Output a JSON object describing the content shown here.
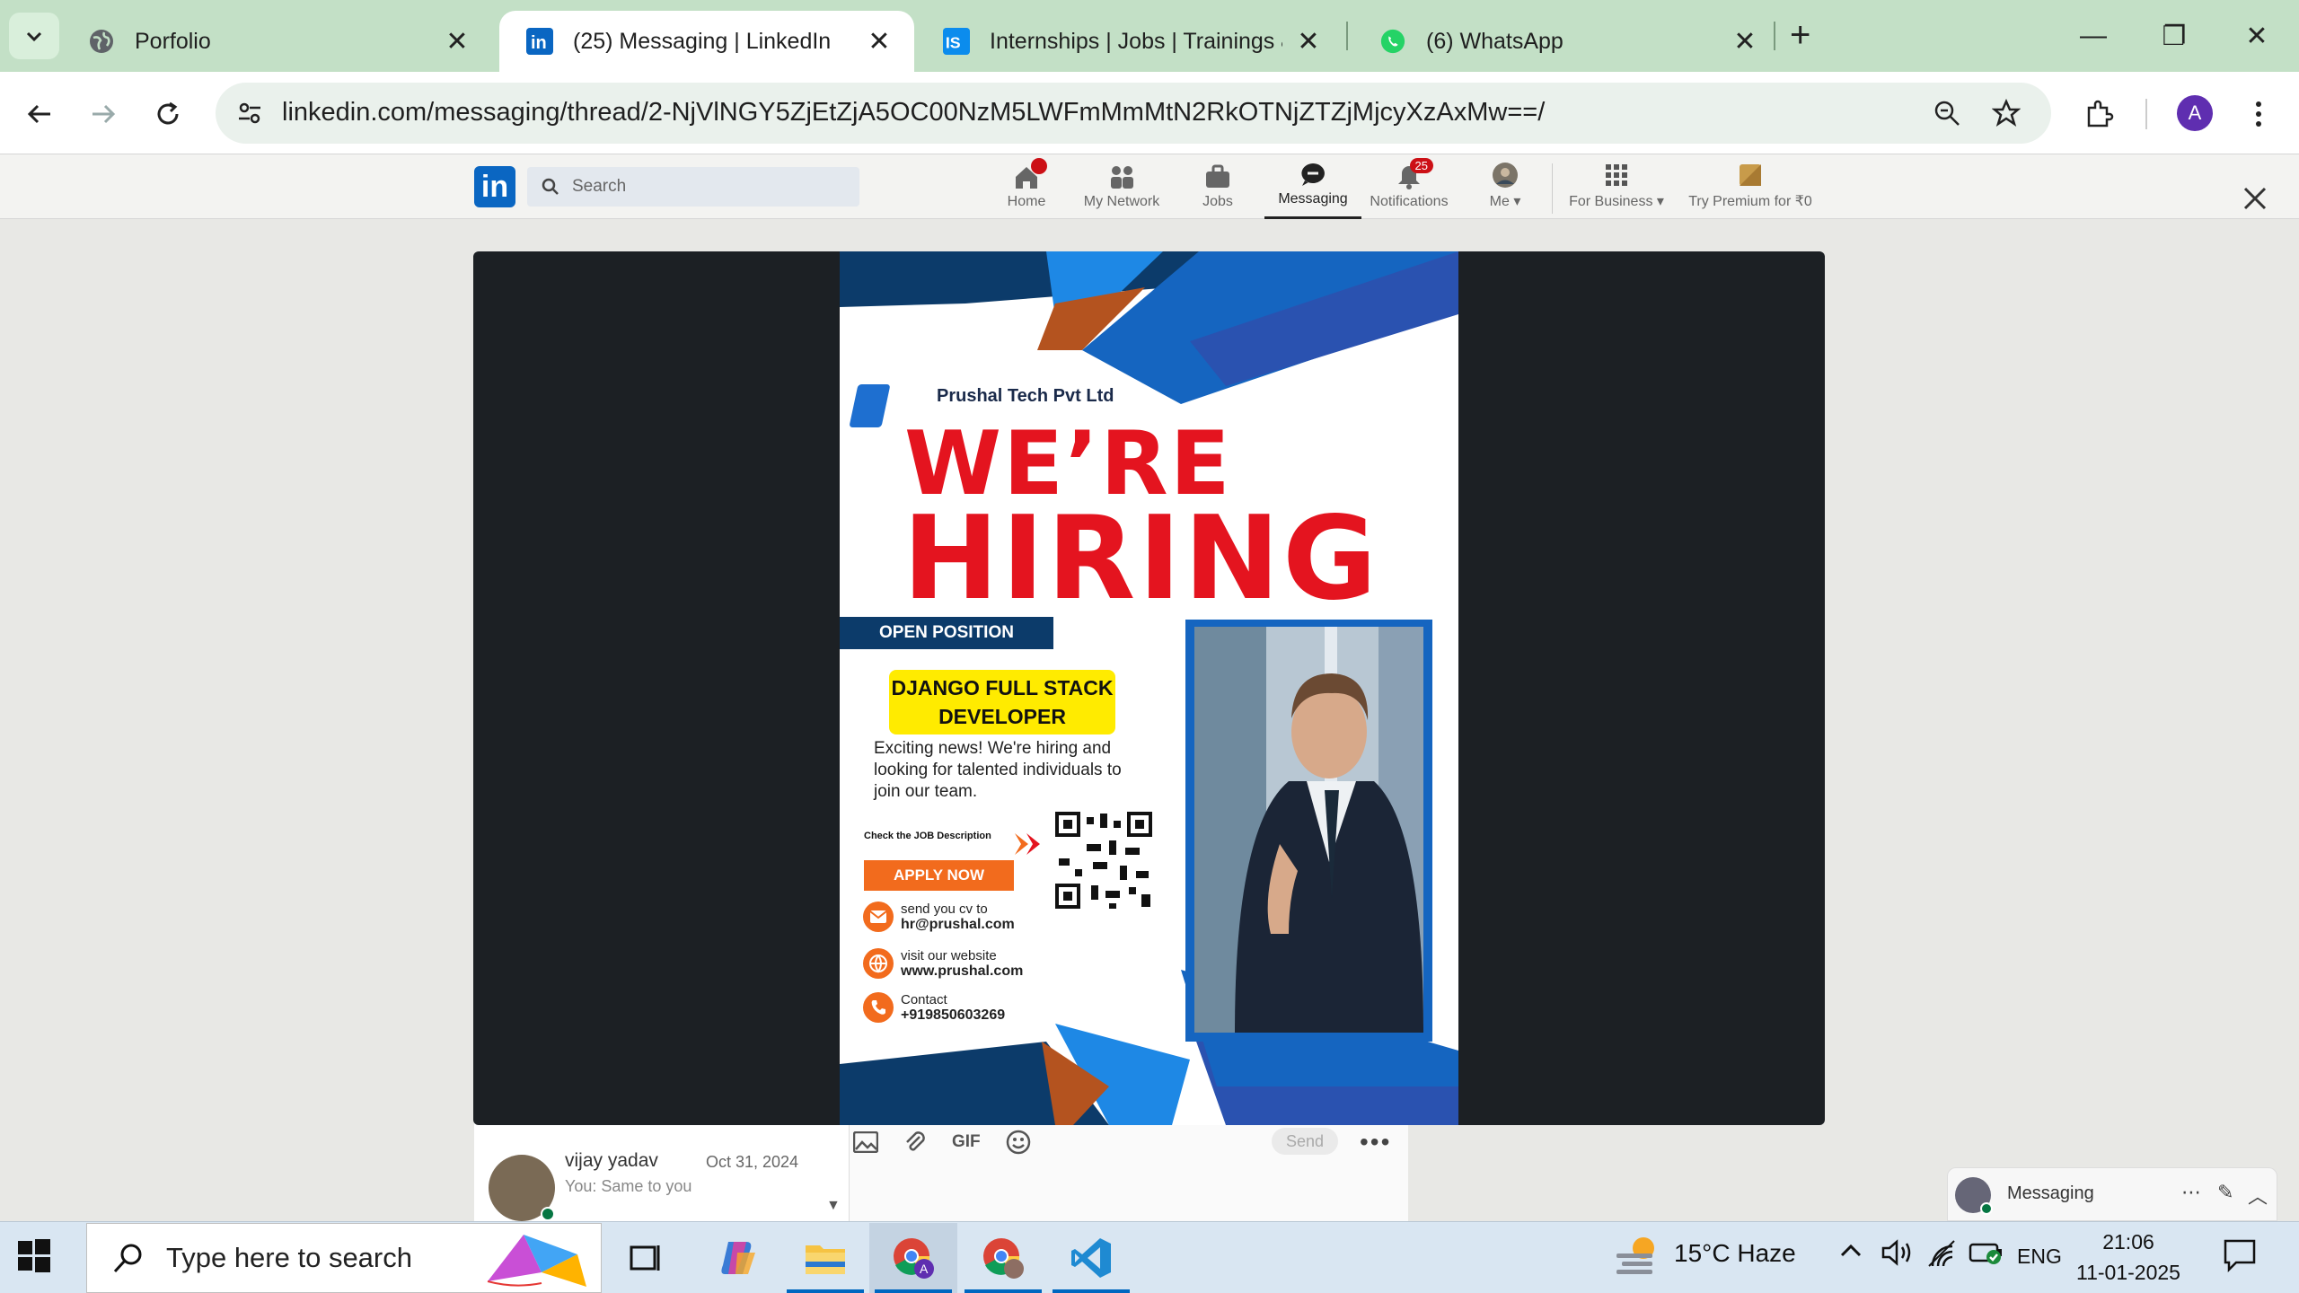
{
  "browser": {
    "tabs": [
      {
        "title": "Porfolio",
        "favicon": "globe-icon",
        "active": false
      },
      {
        "title": "(25) Messaging | LinkedIn",
        "favicon": "linkedin-icon",
        "active": true
      },
      {
        "title": "Internships | Jobs | Trainings & I",
        "favicon": "internshala-icon",
        "active": false
      },
      {
        "title": "(6) WhatsApp",
        "favicon": "whatsapp-icon",
        "active": false
      }
    ],
    "url": "linkedin.com/messaging/thread/2-NjVlNGY5ZjEtZjA5OC00NzM5LWFmMmMtN2RkOTNjZTZjMjcyXzAxMw==/",
    "profile_initial": "A"
  },
  "linkedin": {
    "search_placeholder": "Search",
    "nav": [
      {
        "label": "Home",
        "icon": "home-icon"
      },
      {
        "label": "My Network",
        "icon": "network-icon"
      },
      {
        "label": "Jobs",
        "icon": "briefcase-icon"
      },
      {
        "label": "Messaging",
        "icon": "chat-icon"
      },
      {
        "label": "Notifications",
        "icon": "bell-icon",
        "badge": "25"
      },
      {
        "label": "Me ▾",
        "icon": "avatar-icon"
      },
      {
        "label": "For Business ▾",
        "icon": "grid-icon"
      },
      {
        "label": "Try Premium for ₹0",
        "icon": "premium-icon"
      }
    ],
    "conversation": {
      "name": "vijay yadav",
      "date": "Oct 31, 2024",
      "preview": "You: Same to you"
    },
    "compose": {
      "gif_label": "GIF",
      "send_label": "Send",
      "more": "•••"
    },
    "mini_messaging_label": "Messaging"
  },
  "poster": {
    "company": "Prushal Tech Pvt Ltd",
    "headline1": "WE’RE",
    "headline2": "HIRING",
    "open_position": "OPEN POSITION",
    "role_line1": "DJANGO FULL STACK",
    "role_line2": "DEVELOPER",
    "description": "Exciting news! We're hiring and looking for talented individuals to join our team.",
    "check_jd": "Check the JOB Description",
    "apply": "APPLY NOW",
    "email_label": "send you cv to",
    "email": "hr@prushal.com",
    "web_label": "visit our website",
    "website": "www.prushal.com",
    "contact_label": "Contact",
    "phone": "+919850603269",
    "colors": {
      "navy": "#0c3b6a",
      "blue": "#1e6fd0",
      "red": "#e4141f",
      "yellow": "#ffeb00",
      "orange": "#f26b1d"
    }
  },
  "taskbar": {
    "search_placeholder": "Type here to search",
    "weather": "15°C  Haze",
    "language": "ENG",
    "time": "21:06",
    "date": "11-01-2025"
  }
}
